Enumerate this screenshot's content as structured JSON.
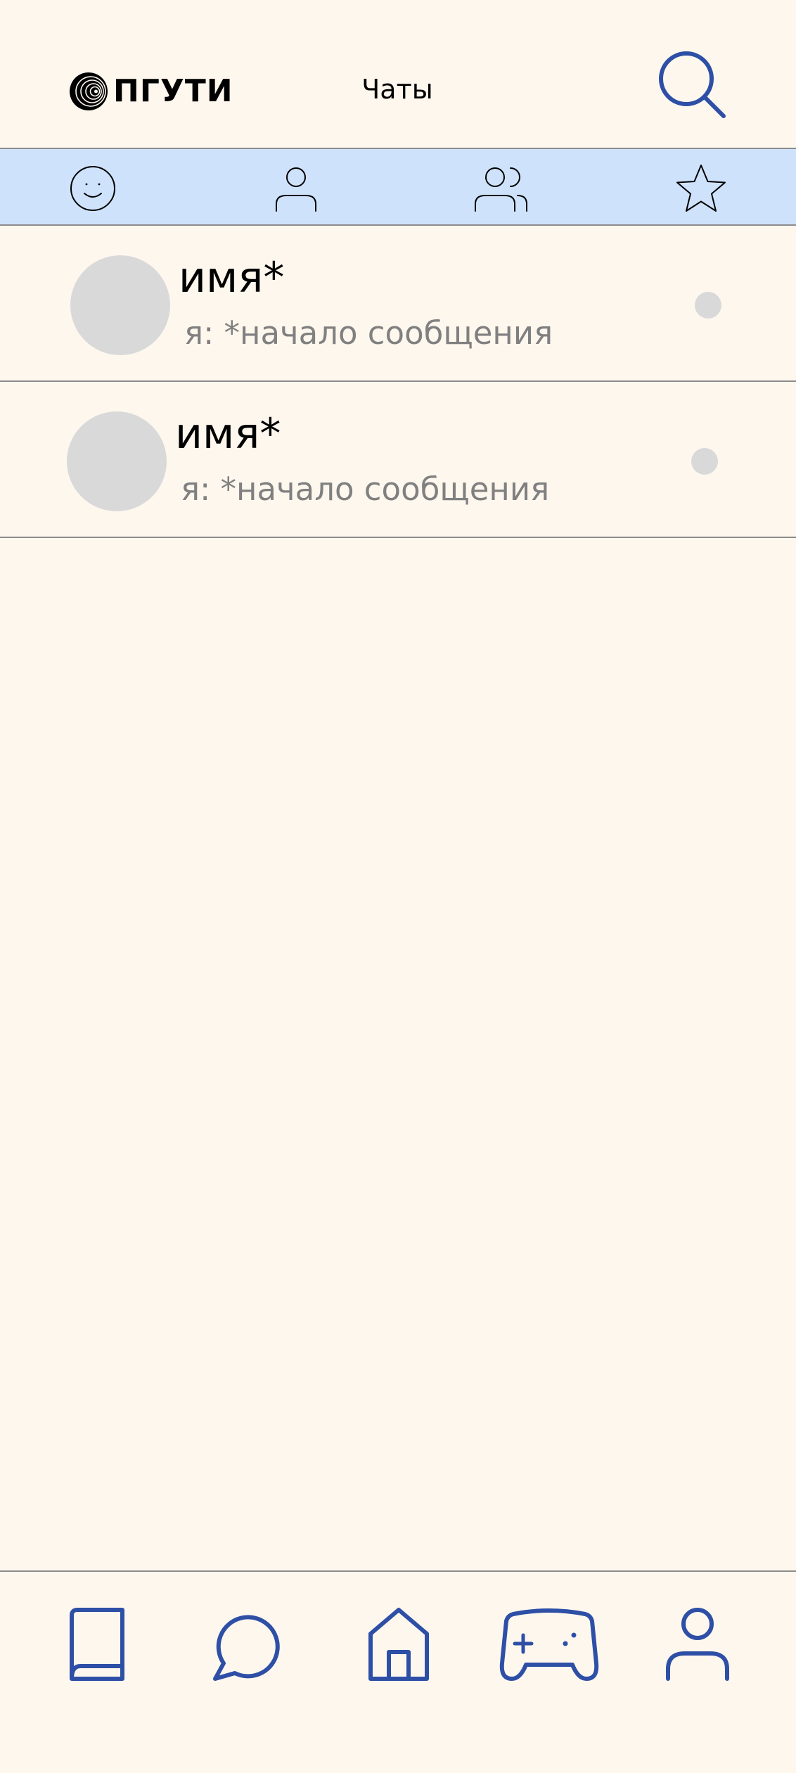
{
  "header": {
    "logo_text": "ПГУТИ",
    "logo_icon": "logo-spiral-icon",
    "title": "Чаты",
    "search_icon": "search-icon"
  },
  "tabs": [
    {
      "icon": "smiley-icon",
      "active": false
    },
    {
      "icon": "person-icon",
      "active": false
    },
    {
      "icon": "people-group-icon",
      "active": false
    },
    {
      "icon": "star-icon",
      "active": false
    }
  ],
  "chats": [
    {
      "name": "имя*",
      "preview": "я: *начало сообщения"
    },
    {
      "name": "имя*",
      "preview": "я: *начало сообщения"
    }
  ],
  "bottom_nav": [
    {
      "icon": "book-icon"
    },
    {
      "icon": "chat-bubble-icon"
    },
    {
      "icon": "home-icon"
    },
    {
      "icon": "gamepad-icon"
    },
    {
      "icon": "profile-icon"
    }
  ],
  "colors": {
    "background": "#FEF7EE",
    "tab_bar": "#CFE2FC",
    "accent": "#2E4FA6",
    "avatar_placeholder": "#D9D9D9",
    "divider": "#8B8B8B",
    "secondary_text": "#808080"
  }
}
